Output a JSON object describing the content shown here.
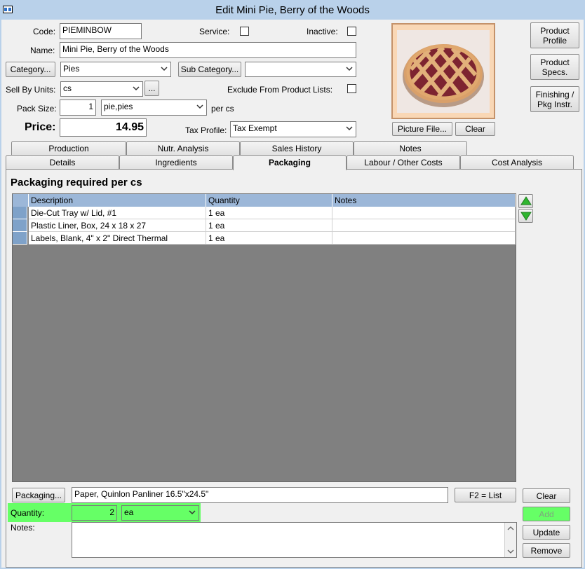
{
  "window": {
    "title": "Edit Mini Pie, Berry of the Woods"
  },
  "fields": {
    "code_label": "Code:",
    "code_value": "PIEMINBOW",
    "service_label": "Service:",
    "inactive_label": "Inactive:",
    "name_label": "Name:",
    "name_value": "Mini Pie, Berry of the Woods",
    "category_button": "Category...",
    "category_value": "Pies",
    "subcategory_button": "Sub Category...",
    "subcategory_value": "",
    "sell_by_units_label": "Sell By Units:",
    "sell_by_units_value": "cs",
    "ellipsis_button": "...",
    "exclude_label": "Exclude From Product Lists:",
    "pack_size_label": "Pack Size:",
    "pack_size_value": "1",
    "pack_unit_value": "pie,pies",
    "per_label": "per cs",
    "price_label": "Price:",
    "price_value": "14.95",
    "tax_profile_label": "Tax Profile:",
    "tax_profile_value": "Tax Exempt"
  },
  "picture": {
    "picture_file_button": "Picture File...",
    "clear_button": "Clear"
  },
  "side_buttons": {
    "product_profile": "Product\nProfile",
    "product_specs": "Product\nSpecs.",
    "finishing": "Finishing /\nPkg Instr."
  },
  "tabs": {
    "back_row": [
      "Production",
      "Nutr. Analysis",
      "Sales History",
      "Notes"
    ],
    "front_row": [
      "Details",
      "Ingredients",
      "Packaging",
      "Labour / Other Costs",
      "Cost Analysis"
    ],
    "active": "Packaging"
  },
  "packaging": {
    "title": "Packaging required per cs",
    "columns": [
      "Description",
      "Quantity",
      "Notes"
    ],
    "rows": [
      {
        "description": "Die-Cut Tray w/ Lid, #1",
        "quantity": "1 ea",
        "notes": ""
      },
      {
        "description": "Plastic Liner, Box, 24 x 18 x 27",
        "quantity": "1 ea",
        "notes": ""
      },
      {
        "description": "Labels, Blank, 4\" x 2\" Direct Thermal",
        "quantity": "1 ea",
        "notes": ""
      }
    ],
    "packaging_button": "Packaging...",
    "packaging_value": "Paper, Quinlon Panliner 16.5\"x24.5\"",
    "list_button": "F2 = List",
    "clear_button": "Clear",
    "quantity_label": "Quantity:",
    "quantity_value": "2",
    "quantity_unit": "ea",
    "add_button": "Add",
    "notes_label": "Notes:",
    "notes_value": "",
    "update_button": "Update",
    "remove_button": "Remove"
  },
  "colors": {
    "title_bar": "#b9d1ea",
    "highlight": "#66ff66",
    "grid_header": "#9cb7d8",
    "grid_bg": "#808080",
    "move_arrows": "#2fb52f"
  }
}
